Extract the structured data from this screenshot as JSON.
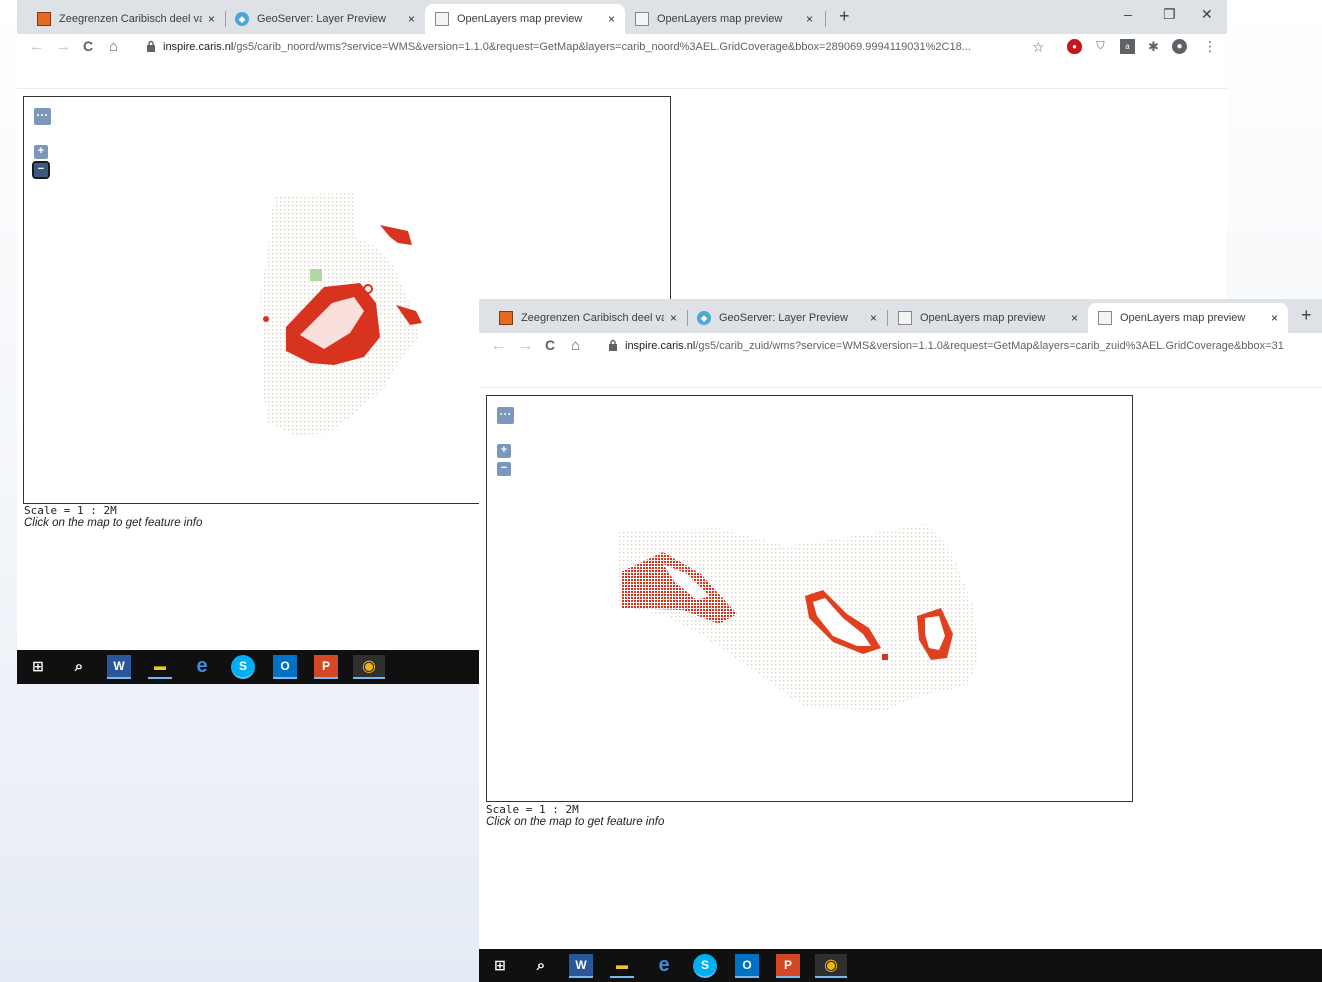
{
  "colors": {
    "accent": "#7b98bc",
    "tabbar": "#dee1e6",
    "taskbar": "#101010",
    "map_red": "#d8331e"
  },
  "tabs": [
    {
      "title": "Zeegrenzen Caribisch deel van h",
      "icon": "layer-favicon"
    },
    {
      "title": "GeoServer: Layer Preview",
      "icon": "geoserver-favicon"
    },
    {
      "title": "OpenLayers map preview",
      "icon": "openlayers-favicon"
    },
    {
      "title": "OpenLayers map preview",
      "icon": "openlayers-favicon"
    }
  ],
  "tab_close": "×",
  "new_tab": "+",
  "window_controls": {
    "minimize": "–",
    "restore": "❐",
    "close": "✕"
  },
  "nav": {
    "back": "←",
    "forward": "→",
    "reload": "C",
    "home": "⌂",
    "star": "☆",
    "menu": "⋮"
  },
  "window1": {
    "url_host": "inspire.caris.nl",
    "url_path": "/gs5/carib_noord/wms?service=WMS&version=1.1.0&request=GetMap&layers=carib_noord%3AEL.GridCoverage&bbox=289069.9994119031%2C18..."
  },
  "window2": {
    "url_host": "inspire.caris.nl",
    "url_path": "/gs5/carib_zuid/wms?service=WMS&version=1.1.0&request=GetMap&layers=carib_zuid%3AEL.GridCoverage&bbox=31"
  },
  "map_controls": {
    "layer_switcher": "···",
    "zoom_in": "+",
    "zoom_out": "−"
  },
  "scale": "Scale = 1 : 2M",
  "hint": "Click on the map to get feature info",
  "taskbar_apps": [
    {
      "name": "windows-start-icon",
      "label": "⊞"
    },
    {
      "name": "search-icon",
      "label": "⌕"
    },
    {
      "name": "word-icon",
      "label": "W"
    },
    {
      "name": "file-explorer-icon",
      "label": "▬"
    },
    {
      "name": "edge-icon",
      "label": "e"
    },
    {
      "name": "skype-icon",
      "label": "S"
    },
    {
      "name": "outlook-icon",
      "label": "O"
    },
    {
      "name": "powerpoint-icon",
      "label": "P"
    },
    {
      "name": "chrome-icon",
      "label": "◉"
    }
  ]
}
